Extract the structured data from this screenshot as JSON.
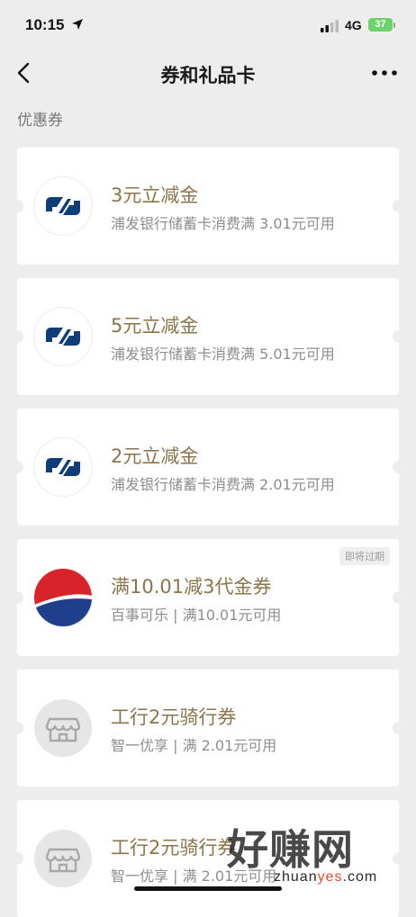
{
  "status_bar": {
    "time": "10:15",
    "network": "4G",
    "battery": "37"
  },
  "nav": {
    "title": "券和礼品卡"
  },
  "section": {
    "title": "优惠券"
  },
  "coupons": [
    {
      "title": "3元立减金",
      "subtitle": "浦发银行储蓄卡消费满 3.01元可用",
      "logo": "spdb-logo"
    },
    {
      "title": "5元立减金",
      "subtitle": "浦发银行储蓄卡消费满 5.01元可用",
      "logo": "spdb-logo"
    },
    {
      "title": "2元立减金",
      "subtitle": "浦发银行储蓄卡消费满 2.01元可用",
      "logo": "spdb-logo"
    },
    {
      "title": "满10.01减3代金券",
      "subtitle": "百事可乐 | 满10.01元可用",
      "logo": "pepsi-logo",
      "badge": "即将过期"
    },
    {
      "title": "工行2元骑行券",
      "subtitle": "智一优享 | 满 2.01元可用",
      "logo": "store-icon"
    },
    {
      "title": "工行2元骑行券",
      "subtitle": "智一优享 | 满 2.01元可用",
      "logo": "store-icon"
    }
  ],
  "watermark": {
    "text": "好赚网",
    "domain_prefix": "zhuan",
    "domain_accent": "yes",
    "domain_suffix": ".com"
  },
  "colors": {
    "background": "#ededed",
    "coupon_title": "#8b7549",
    "spdb_blue": "#0f3d7a",
    "pepsi_red": "#d8232a",
    "pepsi_blue": "#1f3f8c"
  }
}
